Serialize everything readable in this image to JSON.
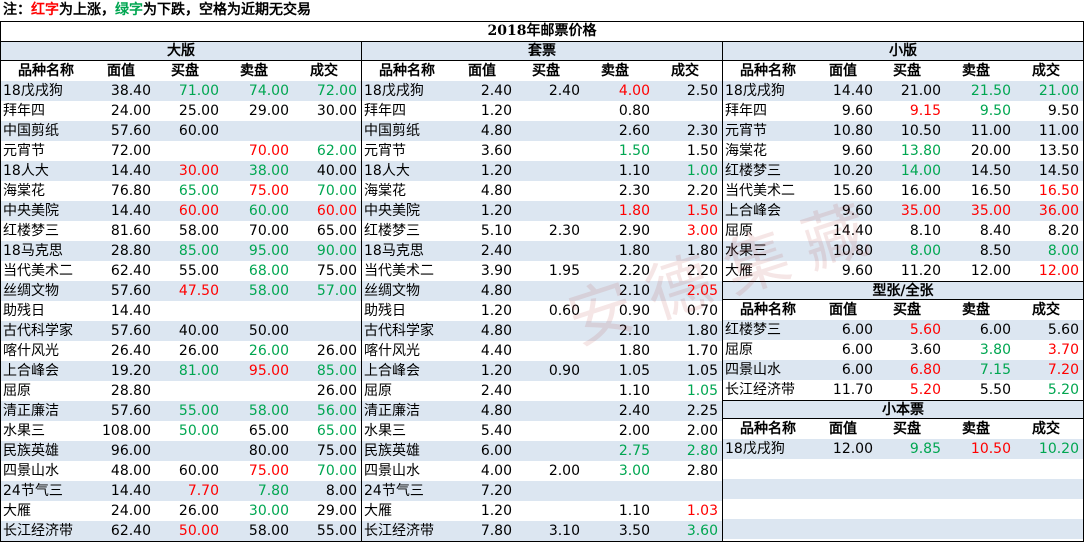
{
  "note": {
    "prefix": "注：",
    "red": "红字",
    "mid1": "为上涨，",
    "green": "绿字",
    "suffix": "为下跌，空格为近期无交易"
  },
  "title": "2018年邮票价格",
  "watermark": "安德集藏",
  "headers": [
    "品种名称",
    "面值",
    "买盘",
    "卖盘",
    "成交"
  ],
  "colors": {
    "up": "#ff0000",
    "down": "#00a651",
    "band": "#dce6f1"
  },
  "sections": {
    "dajiban": {
      "label": "大版",
      "rows": [
        {
          "n": "18戊戌狗",
          "v": "38.40",
          "b": "71.00",
          "bc": "down",
          "s": "74.00",
          "sc": "down",
          "t": "72.00",
          "tc": "down"
        },
        {
          "n": "拜年四",
          "v": "24.00",
          "b": "25.00",
          "s": "29.00",
          "t": "30.00"
        },
        {
          "n": "中国剪纸",
          "v": "57.60",
          "b": "60.00",
          "s": "",
          "t": ""
        },
        {
          "n": "元宵节",
          "v": "72.00",
          "b": "",
          "s": "70.00",
          "sc": "up",
          "t": "62.00",
          "tc": "down"
        },
        {
          "n": "18人大",
          "v": "14.40",
          "b": "30.00",
          "bc": "up",
          "s": "38.00",
          "sc": "down",
          "t": "40.00"
        },
        {
          "n": "海棠花",
          "v": "76.80",
          "b": "65.00",
          "bc": "down",
          "s": "75.00",
          "sc": "up",
          "t": "70.00",
          "tc": "down"
        },
        {
          "n": "中央美院",
          "v": "14.40",
          "b": "60.00",
          "bc": "up",
          "s": "60.00",
          "sc": "down",
          "t": "60.00",
          "tc": "up"
        },
        {
          "n": "红楼梦三",
          "v": "81.60",
          "b": "58.00",
          "s": "70.00",
          "t": "65.00"
        },
        {
          "n": "18马克思",
          "v": "28.80",
          "b": "85.00",
          "bc": "down",
          "s": "95.00",
          "sc": "down",
          "t": "90.00",
          "tc": "down"
        },
        {
          "n": "当代美术二",
          "v": "62.40",
          "b": "55.00",
          "s": "68.00",
          "sc": "down",
          "t": "75.00"
        },
        {
          "n": "丝绸文物",
          "v": "57.60",
          "b": "47.50",
          "bc": "up",
          "s": "58.00",
          "sc": "down",
          "t": "57.00",
          "tc": "down"
        },
        {
          "n": "助残日",
          "v": "14.40",
          "b": "",
          "s": "",
          "t": ""
        },
        {
          "n": "古代科学家",
          "v": "57.60",
          "b": "40.00",
          "s": "50.00",
          "t": ""
        },
        {
          "n": "喀什风光",
          "v": "26.40",
          "b": "26.00",
          "s": "26.00",
          "sc": "down",
          "t": "26.00"
        },
        {
          "n": "上合峰会",
          "v": "19.20",
          "b": "81.00",
          "bc": "down",
          "s": "95.00",
          "sc": "up",
          "t": "85.00",
          "tc": "down"
        },
        {
          "n": "屈原",
          "v": "28.80",
          "b": "",
          "s": "",
          "t": "26.00"
        },
        {
          "n": "清正廉洁",
          "v": "57.60",
          "b": "55.00",
          "bc": "down",
          "s": "58.00",
          "sc": "down",
          "t": "56.00",
          "tc": "down"
        },
        {
          "n": "水果三",
          "v": "108.00",
          "b": "50.00",
          "bc": "down",
          "s": "65.00",
          "t": "65.00",
          "tc": "down"
        },
        {
          "n": "民族英雄",
          "v": "96.00",
          "b": "",
          "s": "80.00",
          "t": "75.00"
        },
        {
          "n": "四景山水",
          "v": "48.00",
          "b": "60.00",
          "s": "75.00",
          "sc": "up",
          "t": "70.00",
          "tc": "down"
        },
        {
          "n": "24节气三",
          "v": "14.40",
          "b": "7.70",
          "bc": "up",
          "s": "7.80",
          "sc": "down",
          "t": "8.00"
        },
        {
          "n": "大雁",
          "v": "24.00",
          "b": "26.00",
          "s": "30.00",
          "sc": "down",
          "t": "29.00"
        },
        {
          "n": "长江经济带",
          "v": "62.40",
          "b": "50.00",
          "bc": "up",
          "s": "58.00",
          "t": "55.00"
        }
      ]
    },
    "taopiao": {
      "label": "套票",
      "rows": [
        {
          "n": "18戊戌狗",
          "v": "2.40",
          "b": "2.40",
          "s": "4.00",
          "sc": "up",
          "t": "2.50"
        },
        {
          "n": "拜年四",
          "v": "1.20",
          "b": "",
          "s": "0.80",
          "t": ""
        },
        {
          "n": "中国剪纸",
          "v": "4.80",
          "b": "",
          "s": "2.60",
          "t": "2.30"
        },
        {
          "n": "元宵节",
          "v": "3.60",
          "b": "",
          "s": "1.50",
          "sc": "down",
          "t": "1.50"
        },
        {
          "n": "18人大",
          "v": "1.20",
          "b": "",
          "s": "1.10",
          "t": "1.00",
          "tc": "down"
        },
        {
          "n": "海棠花",
          "v": "4.80",
          "b": "",
          "s": "2.30",
          "t": "2.20"
        },
        {
          "n": "中央美院",
          "v": "1.20",
          "b": "",
          "s": "1.80",
          "sc": "up",
          "t": "1.50",
          "tc": "up"
        },
        {
          "n": "红楼梦三",
          "v": "5.10",
          "b": "2.30",
          "s": "2.90",
          "t": "3.00",
          "tc": "up"
        },
        {
          "n": "18马克思",
          "v": "2.40",
          "b": "",
          "s": "1.80",
          "t": "1.80"
        },
        {
          "n": "当代美术二",
          "v": "3.90",
          "b": "1.95",
          "s": "2.20",
          "t": "2.20"
        },
        {
          "n": "丝绸文物",
          "v": "4.80",
          "b": "",
          "s": "2.10",
          "t": "2.05",
          "tc": "up"
        },
        {
          "n": "助残日",
          "v": "1.20",
          "b": "0.60",
          "s": "0.90",
          "t": "0.70"
        },
        {
          "n": "古代科学家",
          "v": "4.80",
          "b": "",
          "s": "2.10",
          "t": "1.80"
        },
        {
          "n": "喀什风光",
          "v": "4.40",
          "b": "",
          "s": "1.80",
          "t": "1.70"
        },
        {
          "n": "上合峰会",
          "v": "1.20",
          "b": "0.90",
          "s": "1.05",
          "t": "1.05"
        },
        {
          "n": "屈原",
          "v": "2.40",
          "b": "",
          "s": "1.10",
          "t": "1.05",
          "tc": "down"
        },
        {
          "n": "清正廉洁",
          "v": "4.80",
          "b": "",
          "s": "2.40",
          "t": "2.25"
        },
        {
          "n": "水果三",
          "v": "5.40",
          "b": "",
          "s": "2.00",
          "t": "2.00"
        },
        {
          "n": "民族英雄",
          "v": "6.00",
          "b": "",
          "s": "2.75",
          "sc": "down",
          "t": "2.80",
          "tc": "down"
        },
        {
          "n": "四景山水",
          "v": "4.00",
          "b": "2.00",
          "s": "3.00",
          "sc": "down",
          "t": "2.80"
        },
        {
          "n": "24节气三",
          "v": "7.20",
          "b": "",
          "s": "",
          "t": ""
        },
        {
          "n": "大雁",
          "v": "1.20",
          "b": "",
          "s": "1.10",
          "t": "1.03",
          "tc": "up"
        },
        {
          "n": "长江经济带",
          "v": "7.80",
          "b": "3.10",
          "s": "3.50",
          "t": "3.60",
          "tc": "down"
        }
      ]
    },
    "xiaoban": {
      "label": "小版",
      "rows": [
        {
          "n": "18戊戌狗",
          "v": "14.40",
          "b": "21.00",
          "s": "21.50",
          "sc": "down",
          "t": "21.00",
          "tc": "down"
        },
        {
          "n": "拜年四",
          "v": "9.60",
          "b": "9.15",
          "bc": "up",
          "s": "9.50",
          "sc": "down",
          "t": "9.50"
        },
        {
          "n": "元宵节",
          "v": "10.80",
          "b": "10.50",
          "s": "11.00",
          "t": "11.00"
        },
        {
          "n": "海棠花",
          "v": "9.60",
          "b": "13.80",
          "bc": "down",
          "s": "20.00",
          "t": "13.50"
        },
        {
          "n": "红楼梦三",
          "v": "10.20",
          "b": "14.00",
          "bc": "down",
          "s": "14.50",
          "t": "14.50"
        },
        {
          "n": "当代美术二",
          "v": "15.60",
          "b": "16.00",
          "s": "16.50",
          "t": "16.50",
          "tc": "up"
        },
        {
          "n": "上合峰会",
          "v": "9.60",
          "b": "35.00",
          "bc": "up",
          "s": "35.00",
          "sc": "up",
          "t": "36.00",
          "tc": "up"
        },
        {
          "n": "屈原",
          "v": "14.40",
          "b": "8.10",
          "s": "8.40",
          "t": "8.20"
        },
        {
          "n": "水果三",
          "v": "10.80",
          "b": "8.00",
          "bc": "down",
          "s": "8.50",
          "t": "8.00",
          "tc": "down"
        },
        {
          "n": "大雁",
          "v": "9.60",
          "b": "11.20",
          "s": "12.00",
          "t": "12.00",
          "tc": "up"
        }
      ]
    },
    "xingzhang": {
      "label": "型张/全张",
      "rows": [
        {
          "n": "红楼梦三",
          "v": "6.00",
          "b": "5.60",
          "bc": "up",
          "s": "6.00",
          "t": "5.60"
        },
        {
          "n": "屈原",
          "v": "6.00",
          "b": "3.60",
          "s": "3.80",
          "sc": "down",
          "t": "3.70",
          "tc": "up"
        },
        {
          "n": "四景山水",
          "v": "6.00",
          "b": "6.80",
          "bc": "up",
          "s": "7.15",
          "sc": "down",
          "t": "7.20",
          "tc": "up"
        },
        {
          "n": "长江经济带",
          "v": "11.70",
          "b": "5.20",
          "bc": "up",
          "s": "5.50",
          "t": "5.20",
          "tc": "down"
        }
      ]
    },
    "xiaobenpiao": {
      "label": "小本票",
      "rows": [
        {
          "n": "18戊戌狗",
          "v": "12.00",
          "b": "9.85",
          "bc": "down",
          "s": "10.50",
          "sc": "up",
          "t": "10.20",
          "tc": "down"
        }
      ]
    }
  }
}
